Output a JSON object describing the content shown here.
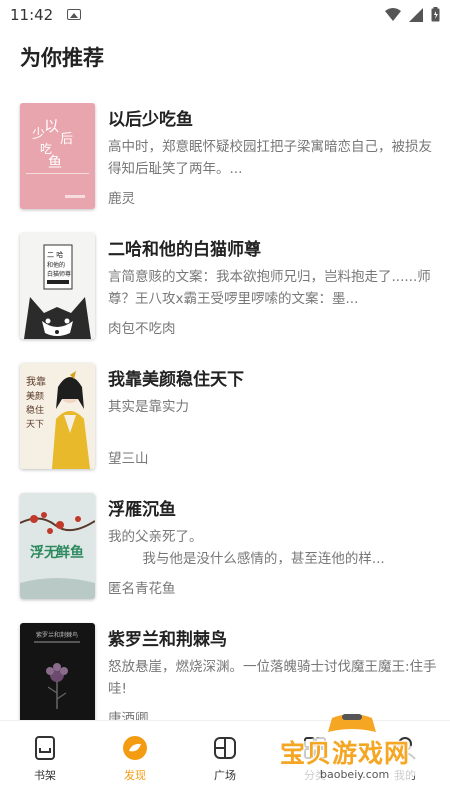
{
  "status": {
    "time": "11:42"
  },
  "page_title": "为你推荐",
  "books": [
    {
      "title": "以后少吃鱼",
      "desc": "高中时，郑意眠怀疑校园扛把子梁寓暗恋自己，被损友得知后耻笑了两年。...",
      "author": "鹿灵",
      "cover_text": "少吃鱼 以后"
    },
    {
      "title": "二哈和他的白猫师尊",
      "desc": "言简意赅的文案：我本欲抱师兄归，岂料抱走了......师尊？王八攻x霸王受啰里啰嗦的文案：墨...",
      "author": "肉包不吃肉",
      "cover_text": "二哈和他的白猫师尊"
    },
    {
      "title": "我靠美颜稳住天下",
      "desc": "其实是靠实力",
      "author": "望三山",
      "cover_text": "我靠美颜稳住天下"
    },
    {
      "title": "浮雁沉鱼",
      "desc": "我的父亲死了。\n        我与他是没什么感情的，甚至连他的样...",
      "author": "匿名青花鱼",
      "cover_text": "浮无鲜鱼"
    },
    {
      "title": "紫罗兰和荆棘鸟",
      "desc": "怒放悬崖，燃烧深渊。一位落魄骑士讨伐魔王魔王:住手哇!",
      "author": "唐酒卿",
      "cover_text": "紫罗兰和荆棘鸟"
    }
  ],
  "tabs": [
    {
      "label": "书架",
      "icon": "bookshelf-icon"
    },
    {
      "label": "发现",
      "icon": "discover-icon",
      "active": true
    },
    {
      "label": "广场",
      "icon": "square-icon"
    },
    {
      "label": "分类",
      "icon": "category-icon"
    },
    {
      "label": "我的",
      "icon": "profile-icon"
    }
  ],
  "watermark": {
    "text": "宝贝游戏网",
    "url": "baobeiy.com"
  },
  "colors": {
    "accent": "#f39c12",
    "text": "#222222",
    "secondary": "#777777"
  }
}
